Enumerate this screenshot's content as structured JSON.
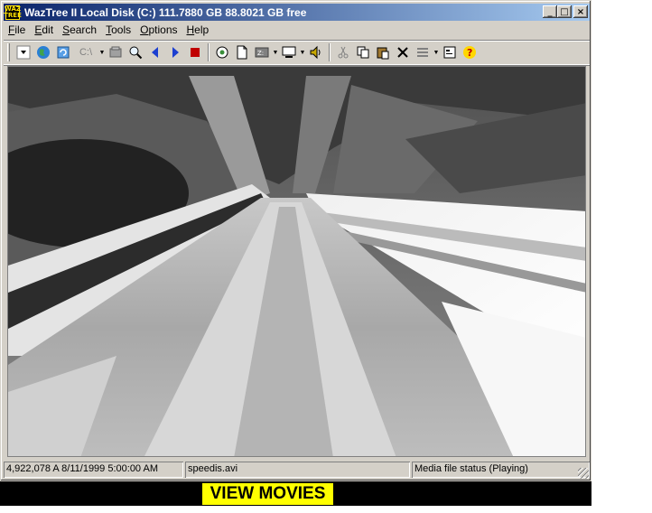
{
  "window": {
    "title": "WazTree II  Local Disk (C:) 111.7880 GB  88.8021 GB free",
    "app_icon_text": "WAZ TREE",
    "controls": {
      "minimize": "_",
      "maximize": "□",
      "close": "×"
    }
  },
  "menu": [
    {
      "accel": "F",
      "rest": "ile"
    },
    {
      "accel": "E",
      "rest": "dit"
    },
    {
      "accel": "S",
      "rest": "earch"
    },
    {
      "accel": "T",
      "rest": "ools"
    },
    {
      "accel": "O",
      "rest": "ptions"
    },
    {
      "accel": "H",
      "rest": "elp"
    }
  ],
  "toolbar": {
    "drive_label": "C:\\",
    "icons": [
      "combo-icon",
      "globe-icon",
      "refresh-icon",
      "drive-icon",
      "folder-icon",
      "find-icon",
      "back-arrow-icon",
      "forward-arrow-icon",
      "stop-icon",
      "explore-icon",
      "page-icon",
      "zip-icon",
      "screen-icon",
      "speaker-icon",
      "cut-icon",
      "copy-icon",
      "paste-icon",
      "delete-icon",
      "view-icon",
      "properties-icon",
      "help-icon"
    ]
  },
  "viewer": {
    "content": "video frame: escalator perspective"
  },
  "status": {
    "file_info": "4,922,078 A 8/11/1999 5:00:00 AM",
    "file_name": "speedis.avi",
    "media_status": "Media file status (Playing)"
  },
  "banner": {
    "label": "VIEW MOVIES"
  },
  "colors": {
    "titlebar_start": "#0a246a",
    "titlebar_end": "#a6caf0",
    "chrome": "#d4d0c8",
    "banner_bg": "#000000",
    "banner_label_bg": "#ffff00"
  }
}
